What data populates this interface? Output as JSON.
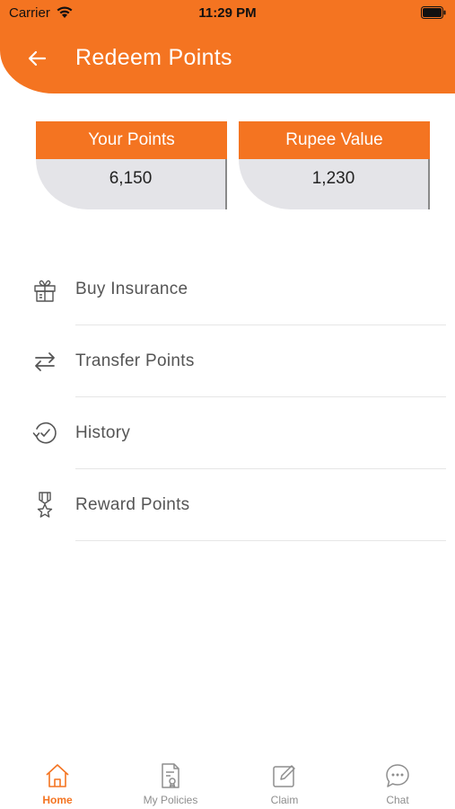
{
  "status_bar": {
    "carrier": "Carrier",
    "time": "11:29 PM"
  },
  "header": {
    "title": "Redeem Points",
    "accent": "#f47421"
  },
  "cards": [
    {
      "title": "Your Points",
      "value": "6,150"
    },
    {
      "title": "Rupee Value",
      "value": "1,230"
    }
  ],
  "menu": [
    {
      "label": "Buy Insurance",
      "icon": "gift-box-icon"
    },
    {
      "label": "Transfer Points",
      "icon": "transfer-arrows-icon"
    },
    {
      "label": "History",
      "icon": "history-clock-icon"
    },
    {
      "label": "Reward Points",
      "icon": "medal-star-icon"
    }
  ],
  "tabs": [
    {
      "label": "Home",
      "icon": "home-icon",
      "active": true
    },
    {
      "label": "My Policies",
      "icon": "policy-document-icon",
      "active": false
    },
    {
      "label": "Claim",
      "icon": "claim-edit-icon",
      "active": false
    },
    {
      "label": "Chat",
      "icon": "chat-bubble-icon",
      "active": false
    }
  ]
}
